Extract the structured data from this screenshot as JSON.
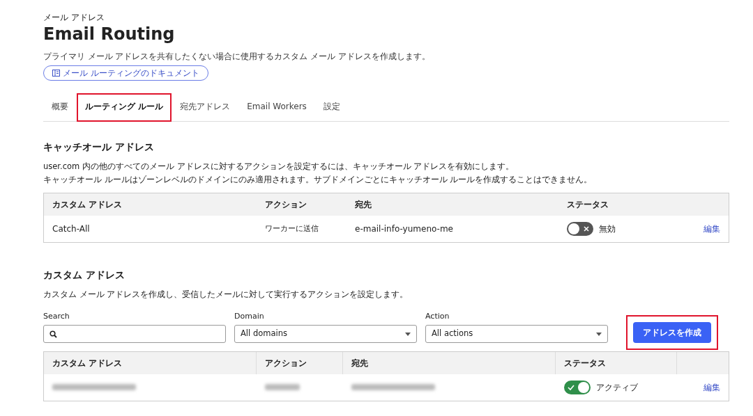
{
  "header": {
    "eyebrow": "メール アドレス",
    "title": "Email Routing",
    "description": "プライマリ メール アドレスを共有したくない場合に使用するカスタム メール アドレスを作成します。",
    "doc_link": "メール ルーティングのドキュメント"
  },
  "tabs": [
    {
      "label": "概要",
      "selected": false,
      "highlighted": false
    },
    {
      "label": "ルーティング ルール",
      "selected": true,
      "highlighted": true
    },
    {
      "label": "宛先アドレス",
      "selected": false,
      "highlighted": false
    },
    {
      "label": "Email Workers",
      "selected": false,
      "highlighted": false
    },
    {
      "label": "設定",
      "selected": false,
      "highlighted": false
    }
  ],
  "catch_all": {
    "title": "キャッチオール アドレス",
    "lines": [
      "user.com 内の他のすべてのメール アドレスに対するアクションを設定するには、キャッチオール アドレスを有効にします。",
      "キャッチオール ルールはゾーンレベルのドメインにのみ適用されます。サブドメインごとにキャッチオール ルールを作成することはできません。"
    ],
    "columns": [
      "カスタム アドレス",
      "アクション",
      "宛先",
      "ステータス"
    ],
    "rows": [
      {
        "blurred": false,
        "address": "Catch-All",
        "action": "ワーカーに送信",
        "destination": "e-mail-info-yumeno-me",
        "on": false,
        "status": "無効",
        "edit": "編集"
      }
    ]
  },
  "custom": {
    "title": "カスタム アドレス",
    "description": "カスタム メール アドレスを作成し、受信したメールに対して実行するアクションを設定します。",
    "filters": [
      {
        "kind": "search",
        "label": "Search"
      },
      {
        "kind": "select",
        "label": "Domain",
        "value": "All domains"
      },
      {
        "kind": "select",
        "label": "Action",
        "value": "All actions"
      }
    ],
    "create_button": {
      "label": "アドレスを作成",
      "highlighted": true
    },
    "columns": [
      "カスタム アドレス",
      "アクション",
      "宛先",
      "ステータス"
    ],
    "rows": [
      {
        "blurred": true,
        "on": true,
        "status": "アクティブ",
        "edit": "編集"
      }
    ]
  }
}
